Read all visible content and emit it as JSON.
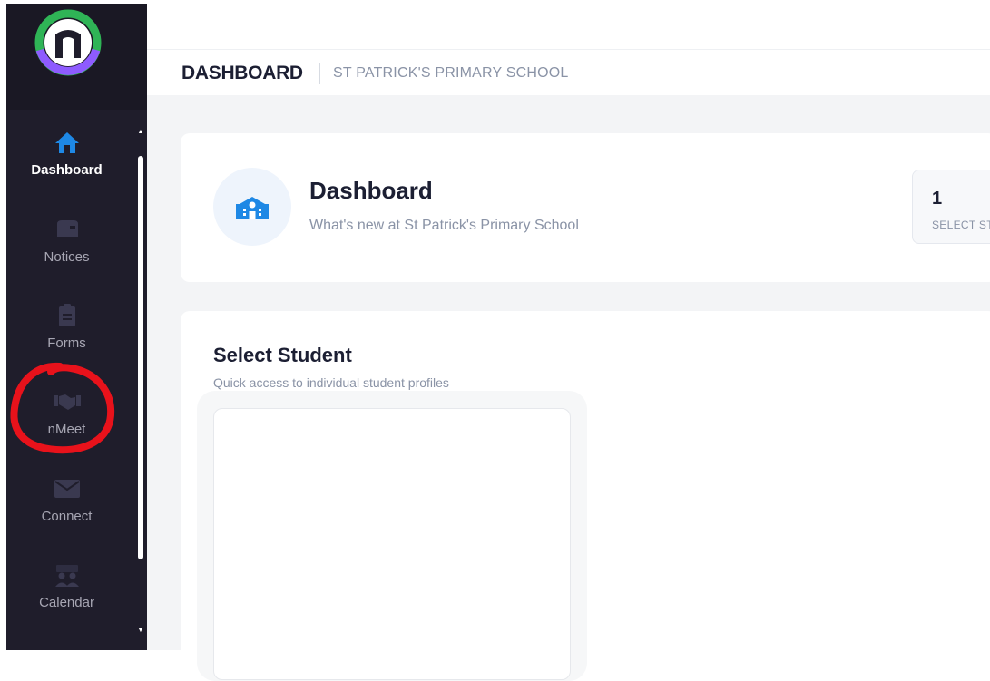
{
  "sidebar": {
    "items": [
      {
        "label": "Dashboard",
        "icon": "home-icon",
        "active": true
      },
      {
        "label": "Notices",
        "icon": "mailbox-icon",
        "active": false
      },
      {
        "label": "Forms",
        "icon": "clipboard-icon",
        "active": false
      },
      {
        "label": "nMeet",
        "icon": "handshake-icon",
        "active": false
      },
      {
        "label": "Connect",
        "icon": "envelope-icon",
        "active": false
      },
      {
        "label": "Calendar",
        "icon": "calendar-people-icon",
        "active": false
      }
    ]
  },
  "header": {
    "title": "DASHBOARD",
    "school": "ST PATRICK'S PRIMARY SCHOOL"
  },
  "hero": {
    "title": "Dashboard",
    "subtitle": "What's new at St Patrick's Primary School",
    "stat_value": "1",
    "stat_label": "SELECT STUDENT"
  },
  "select_student": {
    "title": "Select Student",
    "subtitle": "Quick access to individual student profiles"
  },
  "colors": {
    "sidebar": "#1f1d2b",
    "accent_blue": "#1e88e5",
    "annotation_red": "#e8121b"
  }
}
